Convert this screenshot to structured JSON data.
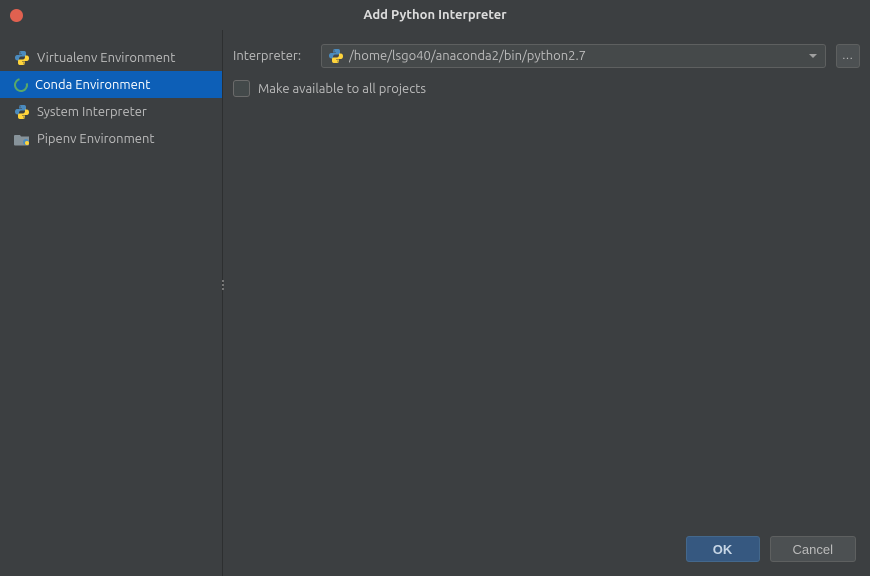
{
  "titlebar": {
    "title": "Add Python Interpreter"
  },
  "sidebar": {
    "items": [
      {
        "id": "virtualenv",
        "label": "Virtualenv Environment",
        "type": "python"
      },
      {
        "id": "conda",
        "label": "Conda Environment",
        "type": "conda"
      },
      {
        "id": "system",
        "label": "System Interpreter",
        "type": "python"
      },
      {
        "id": "pipenv",
        "label": "Pipenv Environment",
        "type": "folder"
      }
    ],
    "selected": "conda"
  },
  "form": {
    "interpreter_label": "Interpreter:",
    "interpreter_value": "/home/lsgo40/anaconda2/bin/python2.7",
    "checkbox_label": "Make available to all projects",
    "checkbox_checked": false,
    "browse_label": "..."
  },
  "buttons": {
    "ok": "OK",
    "cancel": "Cancel"
  }
}
